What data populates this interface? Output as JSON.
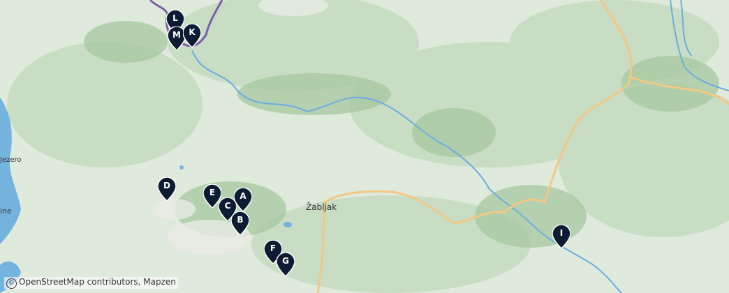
{
  "map": {
    "place_labels": {
      "zabljak": "Žabljak",
      "jezero": "Jezero",
      "left_edge": "ine"
    },
    "markers": [
      {
        "id": "L",
        "label": "L"
      },
      {
        "id": "M",
        "label": "M"
      },
      {
        "id": "K",
        "label": "K"
      },
      {
        "id": "D",
        "label": "D"
      },
      {
        "id": "E",
        "label": "E"
      },
      {
        "id": "A",
        "label": "A"
      },
      {
        "id": "C",
        "label": "C"
      },
      {
        "id": "B",
        "label": "B"
      },
      {
        "id": "F",
        "label": "F"
      },
      {
        "id": "G",
        "label": "G"
      },
      {
        "id": "I",
        "label": "I"
      }
    ],
    "attribution": "OpenStreetMap contributors, Mapzen",
    "colors": {
      "land": "#dfe9dc",
      "forest": "#b9d3b3",
      "water": "#6aaee0",
      "road": "#f2c883",
      "marker": "#0d1b33",
      "border": "#7a5fa8"
    }
  }
}
